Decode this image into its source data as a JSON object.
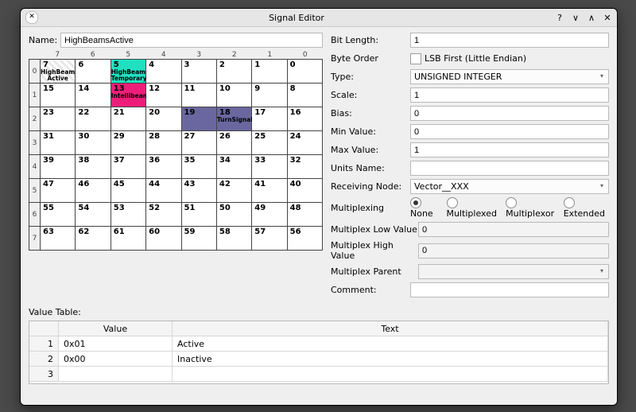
{
  "window": {
    "title": "Signal Editor"
  },
  "name_label": "Name:",
  "name_value": "HighBeamsActive",
  "bit_headers": [
    "7",
    "6",
    "5",
    "4",
    "3",
    "2",
    "1",
    "0"
  ],
  "byte_rows": [
    {
      "label": "0",
      "cells": [
        {
          "n": "7",
          "cls": "hb-active",
          "tag": "HighBeams Active"
        },
        {
          "n": "6"
        },
        {
          "n": "5",
          "cls": "hb-temp",
          "tag": "HighBeams Temporary"
        },
        {
          "n": "4"
        },
        {
          "n": "3"
        },
        {
          "n": "2"
        },
        {
          "n": "1"
        },
        {
          "n": "0"
        }
      ]
    },
    {
      "label": "1",
      "cells": [
        {
          "n": "15"
        },
        {
          "n": "14"
        },
        {
          "n": "13",
          "cls": "intelli",
          "tag": "Intellibeam"
        },
        {
          "n": "12"
        },
        {
          "n": "11"
        },
        {
          "n": "10"
        },
        {
          "n": "9"
        },
        {
          "n": "8"
        }
      ]
    },
    {
      "label": "2",
      "cells": [
        {
          "n": "23"
        },
        {
          "n": "22"
        },
        {
          "n": "21"
        },
        {
          "n": "20"
        },
        {
          "n": "19",
          "cls": "turn"
        },
        {
          "n": "18",
          "cls": "turn",
          "tag": "TurnSignals"
        },
        {
          "n": "17"
        },
        {
          "n": "16"
        }
      ]
    },
    {
      "label": "3",
      "cells": [
        {
          "n": "31"
        },
        {
          "n": "30"
        },
        {
          "n": "29"
        },
        {
          "n": "28"
        },
        {
          "n": "27"
        },
        {
          "n": "26"
        },
        {
          "n": "25"
        },
        {
          "n": "24"
        }
      ]
    },
    {
      "label": "4",
      "cells": [
        {
          "n": "39"
        },
        {
          "n": "38"
        },
        {
          "n": "37"
        },
        {
          "n": "36"
        },
        {
          "n": "35"
        },
        {
          "n": "34"
        },
        {
          "n": "33"
        },
        {
          "n": "32"
        }
      ]
    },
    {
      "label": "5",
      "cells": [
        {
          "n": "47"
        },
        {
          "n": "46"
        },
        {
          "n": "45"
        },
        {
          "n": "44"
        },
        {
          "n": "43"
        },
        {
          "n": "42"
        },
        {
          "n": "41"
        },
        {
          "n": "40"
        }
      ]
    },
    {
      "label": "6",
      "cells": [
        {
          "n": "55"
        },
        {
          "n": "54"
        },
        {
          "n": "53"
        },
        {
          "n": "52"
        },
        {
          "n": "51"
        },
        {
          "n": "50"
        },
        {
          "n": "49"
        },
        {
          "n": "48"
        }
      ]
    },
    {
      "label": "7",
      "cells": [
        {
          "n": "63"
        },
        {
          "n": "62"
        },
        {
          "n": "61"
        },
        {
          "n": "60"
        },
        {
          "n": "59"
        },
        {
          "n": "58"
        },
        {
          "n": "57"
        },
        {
          "n": "56"
        }
      ]
    }
  ],
  "props": {
    "bit_length": {
      "label": "Bit Length:",
      "value": "1"
    },
    "byte_order": {
      "label": "Byte Order",
      "check_label": "LSB First (Little Endian)",
      "checked": false
    },
    "type": {
      "label": "Type:",
      "value": "UNSIGNED INTEGER"
    },
    "scale": {
      "label": "Scale:",
      "value": "1"
    },
    "bias": {
      "label": "Bias:",
      "value": "0"
    },
    "min": {
      "label": "Min Value:",
      "value": "0"
    },
    "max": {
      "label": "Max Value:",
      "value": "1"
    },
    "units": {
      "label": "Units Name:",
      "value": ""
    },
    "recv": {
      "label": "Receiving Node:",
      "value": "Vector__XXX"
    },
    "mux": {
      "label": "Multiplexing",
      "options": [
        "None",
        "Multiplexed",
        "Multiplexor",
        "Extended"
      ],
      "selected": 0
    },
    "mux_lo": {
      "label": "Multiplex Low Value",
      "value": "0"
    },
    "mux_hi": {
      "label": "Multiplex High Value",
      "value": "0"
    },
    "mux_parent": {
      "label": "Multiplex Parent",
      "value": ""
    },
    "comment": {
      "label": "Comment:",
      "value": ""
    }
  },
  "value_table": {
    "label": "Value Table:",
    "headers": {
      "value": "Value",
      "text": "Text"
    },
    "rows": [
      {
        "idx": "1",
        "value": "0x01",
        "text": "Active"
      },
      {
        "idx": "2",
        "value": "0x00",
        "text": "Inactive"
      },
      {
        "idx": "3",
        "value": "",
        "text": ""
      }
    ]
  }
}
